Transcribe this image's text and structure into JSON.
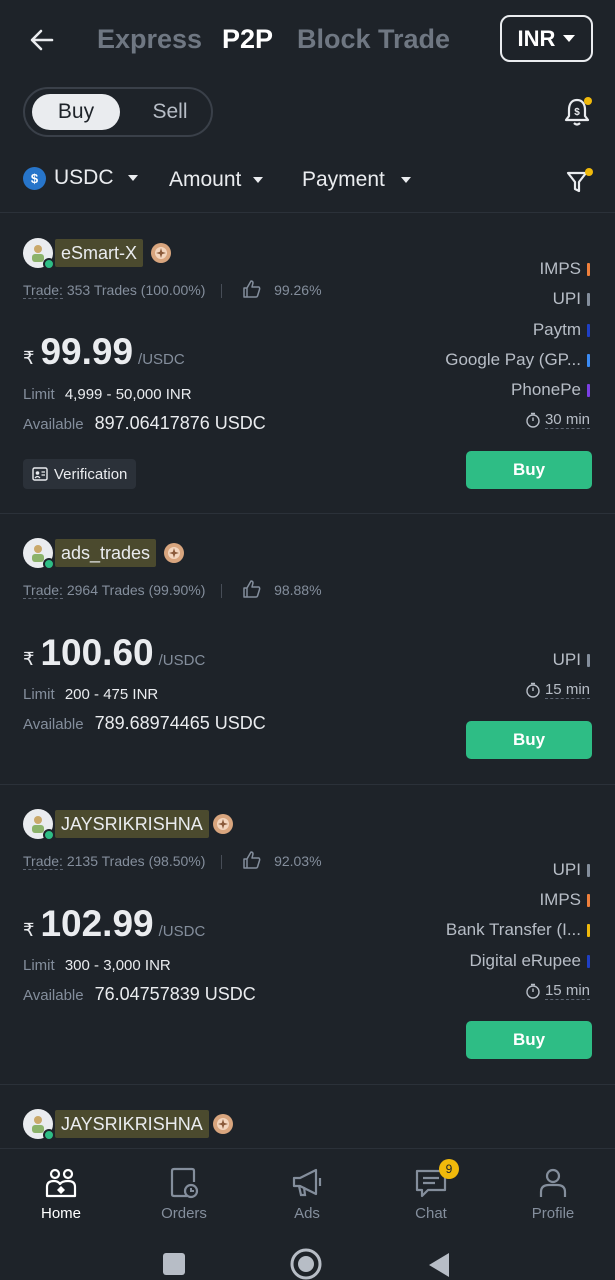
{
  "header": {
    "tabs": [
      "Express",
      "P2P",
      "Block Trade"
    ],
    "active_tab": "P2P",
    "fiat": "INR"
  },
  "toggle": {
    "buy": "Buy",
    "sell": "Sell",
    "active": "Buy"
  },
  "filters": {
    "coin": "USDC",
    "amount": "Amount",
    "payment": "Payment"
  },
  "ads": [
    {
      "name": "eSmart-X",
      "trade_label": "Trade:",
      "trades": "353 Trades",
      "completion": "(100.00%)",
      "positive": "99.26%",
      "currency_symbol": "₹",
      "price": "99.99",
      "unit": "/USDC",
      "limit_label": "Limit",
      "limit": "4,999 - 50,000 INR",
      "available_label": "Available",
      "available": "897.06417876 USDC",
      "verification": "Verification",
      "payments": [
        {
          "name": "IMPS",
          "color": "#f0803c"
        },
        {
          "name": "UPI",
          "color": "#848e9c"
        },
        {
          "name": "Paytm",
          "color": "#1f3fc5"
        },
        {
          "name": "Google Pay (GP...",
          "color": "#3b8cf5"
        },
        {
          "name": "PhonePe",
          "color": "#7b3fe4"
        }
      ],
      "time": "30 min",
      "buy_label": "Buy"
    },
    {
      "name": "ads_trades",
      "trade_label": "Trade:",
      "trades": "2964 Trades",
      "completion": "(99.90%)",
      "positive": "98.88%",
      "currency_symbol": "₹",
      "price": "100.60",
      "unit": "/USDC",
      "limit_label": "Limit",
      "limit": "200 - 475 INR",
      "available_label": "Available",
      "available": "789.68974465 USDC",
      "payments": [
        {
          "name": "UPI",
          "color": "#848e9c"
        }
      ],
      "time": "15 min",
      "buy_label": "Buy"
    },
    {
      "name": "JAYSRIKRISHNA",
      "trade_label": "Trade:",
      "trades": "2135 Trades",
      "completion": "(98.50%)",
      "positive": "92.03%",
      "currency_symbol": "₹",
      "price": "102.99",
      "unit": "/USDC",
      "limit_label": "Limit",
      "limit": "300 - 3,000 INR",
      "available_label": "Available",
      "available": "76.04757839 USDC",
      "payments": [
        {
          "name": "UPI",
          "color": "#848e9c"
        },
        {
          "name": "IMPS",
          "color": "#f0803c"
        },
        {
          "name": "Bank Transfer (I...",
          "color": "#f0b90b"
        },
        {
          "name": "Digital eRupee",
          "color": "#1f3fc5"
        }
      ],
      "time": "15 min",
      "buy_label": "Buy"
    },
    {
      "name": "JAYSRIKRISHNA"
    }
  ],
  "nav": {
    "items": [
      "Home",
      "Orders",
      "Ads",
      "Chat",
      "Profile"
    ],
    "active": "Home",
    "chat_badge": "9"
  },
  "colors": {
    "accent_buy": "#2ebd85",
    "background": "#1e2329",
    "badge": "#f0b90b"
  },
  "icons": [
    "back-arrow-icon",
    "bell-icon",
    "usdc-icon",
    "filter-icon",
    "thumb-up-icon",
    "clock-icon",
    "id-card-icon",
    "medal-icon",
    "home-icon",
    "orders-icon",
    "megaphone-icon",
    "chat-icon",
    "profile-icon"
  ]
}
